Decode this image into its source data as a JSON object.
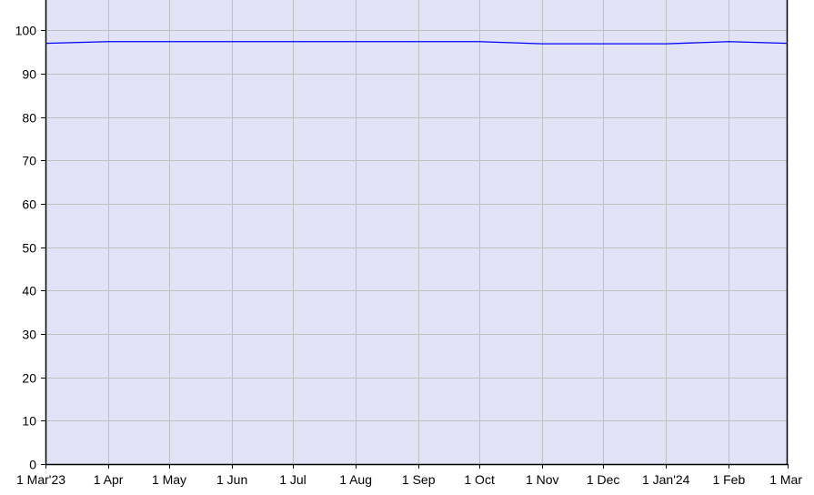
{
  "chart_data": {
    "type": "area",
    "title": "",
    "xlabel": "",
    "ylabel": "",
    "x_tick_labels": [
      "1 Mar'23",
      "1 Apr",
      "1 May",
      "1 Jun",
      "1 Jul",
      "1 Aug",
      "1 Sep",
      "1 Oct",
      "1 Nov",
      "1 Dec",
      "1 Jan'24",
      "1 Feb",
      "1 Mar"
    ],
    "y_ticks": [
      0,
      10,
      20,
      30,
      40,
      50,
      60,
      70,
      80,
      90,
      100
    ],
    "ylim": [
      0,
      107
    ],
    "xlim": [
      "2023-03-01",
      "2024-03-01"
    ],
    "grid": true,
    "legend": "none",
    "series": [
      {
        "x": [
          "2023-03-01",
          "2023-04-01",
          "2023-05-01",
          "2023-06-01",
          "2023-07-01",
          "2023-08-01",
          "2023-09-01",
          "2023-10-01",
          "2023-11-01",
          "2023-12-01",
          "2024-01-01",
          "2024-02-01",
          "2024-03-01"
        ],
        "values": [
          97.0,
          97.4,
          97.4,
          97.4,
          97.4,
          97.4,
          97.4,
          97.4,
          96.9,
          96.9,
          96.9,
          97.4,
          97.0
        ]
      }
    ],
    "colors": {
      "plot_background": "#e3e3f8",
      "line": "#0000ff",
      "grid": "#c0c0c0",
      "axis": "#000000"
    }
  }
}
